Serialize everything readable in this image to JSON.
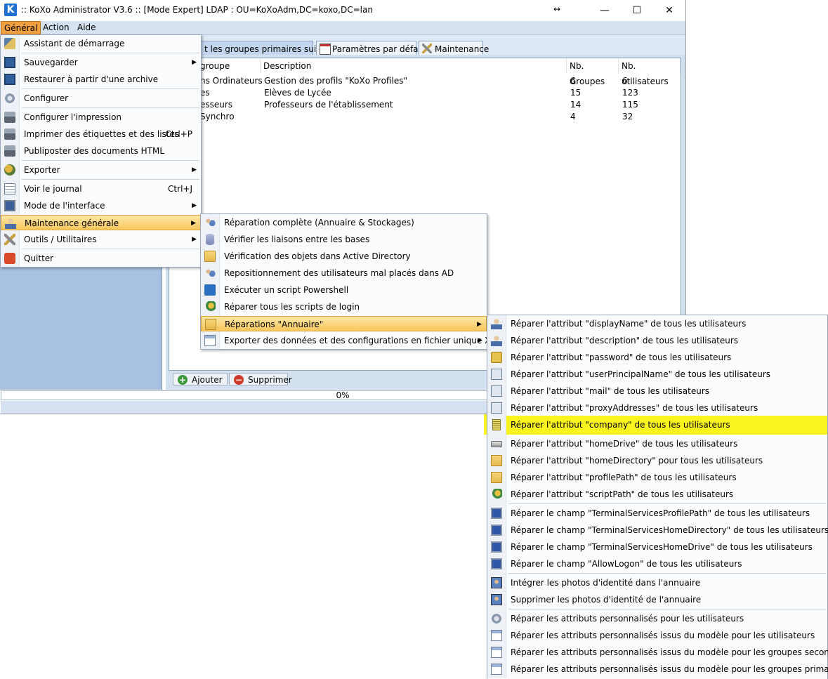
{
  "window": {
    "title": ":: KoXo Administrator V3.6 :: [Mode Expert] LDAP : OU=KoXoAdm,DC=koxo,DC=lan",
    "logo_letter": "K",
    "resize_glyph": "↔",
    "minimize_glyph": "—",
    "maximize_glyph": "☐",
    "close_glyph": "✕"
  },
  "menubar": {
    "items": [
      {
        "label": "Général"
      },
      {
        "label": "Action"
      },
      {
        "label": "Aide"
      }
    ]
  },
  "tabs": [
    {
      "label": "t les groupes primaires suivants",
      "icon": "group-icon"
    },
    {
      "label": "Paramètres par défaut",
      "icon": "calendar-icon"
    },
    {
      "label": "Maintenance",
      "icon": "tools-icon"
    }
  ],
  "grid": {
    "columns": [
      "groupe",
      "Description",
      "Nb. Groupes",
      "Nb. utilisateurs"
    ],
    "rows": [
      {
        "groupe": "ns Ordinateurs",
        "description": "Gestion des profils \"KoXo Profiles\"",
        "nb_groupes": "6",
        "nb_users": "6"
      },
      {
        "groupe": "es",
        "description": "Elèves de Lycée",
        "nb_groupes": "15",
        "nb_users": "123"
      },
      {
        "groupe": "esseurs",
        "description": "Professeurs de l'établissement",
        "nb_groupes": "14",
        "nb_users": "115"
      },
      {
        "groupe": "Synchro",
        "description": "",
        "nb_groupes": "4",
        "nb_users": "32"
      }
    ]
  },
  "bottom_toolbar": {
    "add_label": "Ajouter",
    "delete_label": "Supprimer"
  },
  "progress": {
    "text": "0%",
    "value": 0
  },
  "menu_general": {
    "items": [
      {
        "label": "Assistant de démarrage",
        "icon": "wizard-icon"
      },
      {
        "label": "Sauvegarder",
        "icon": "save-icon",
        "submenu": true
      },
      {
        "label": "Restaurer à partir d'une archive",
        "icon": "restore-icon"
      },
      {
        "label": "Configurer",
        "icon": "gear-icon"
      },
      {
        "label": "Configurer l'impression",
        "icon": "printer-icon"
      },
      {
        "label": "Imprimer des étiquettes et des listes",
        "icon": "printer-icon",
        "shortcut": "Ctrl+P"
      },
      {
        "label": "Publiposter des documents HTML",
        "icon": "printer-icon"
      },
      {
        "label": "Exporter",
        "icon": "export-icon",
        "submenu": true
      },
      {
        "label": "Voir le journal",
        "icon": "log-icon",
        "shortcut": "Ctrl+J"
      },
      {
        "label": "Mode de l'interface",
        "icon": "monitor-icon",
        "submenu": true
      },
      {
        "label": "Maintenance générale",
        "icon": "user-icon",
        "submenu": true
      },
      {
        "label": "Outils / Utilitaires",
        "icon": "tools-icon",
        "submenu": true
      },
      {
        "label": "Quitter",
        "icon": "quit-icon"
      }
    ]
  },
  "menu_maintenance": {
    "items": [
      {
        "label": "Réparation complète (Annuaire & Stockages)",
        "icon": "users-icon"
      },
      {
        "label": "Vérifier les liaisons entre les bases",
        "icon": "database-icon"
      },
      {
        "label": "Vérification des objets dans Active Directory",
        "icon": "folder-icon"
      },
      {
        "label": "Repositionnement des utilisateurs mal placés dans AD",
        "icon": "users-icon"
      },
      {
        "label": "Exécuter un script Powershell",
        "icon": "powershell-icon"
      },
      {
        "label": "Réparer tous les scripts de login",
        "icon": "script-icon"
      },
      {
        "label": "Réparations \"Annuaire\"",
        "icon": "folder-icon",
        "submenu": true
      },
      {
        "label": "Exporter des données et des configurations en fichier unique XML",
        "icon": "export-xml-icon",
        "submenu": true
      }
    ]
  },
  "menu_annuaire": {
    "items": [
      {
        "label": "Réparer l'attribut \"displayName\" de tous les utilisateurs",
        "icon": "user-icon"
      },
      {
        "label": "Réparer l'attribut \"description\" de tous les utilisateurs",
        "icon": "user-icon"
      },
      {
        "label": "Réparer l'attribut \"password\" de tous les utilisateurs",
        "icon": "key-icon"
      },
      {
        "label": "Réparer l'attribut \"userPrincipalName\" de tous les utilisateurs",
        "icon": "id-card-icon"
      },
      {
        "label": "Réparer l'attribut \"mail\" de tous les utilisateurs",
        "icon": "id-card-icon"
      },
      {
        "label": "Réparer l'attribut \"proxyAddresses\" de tous les utilisateurs",
        "icon": "id-card-icon"
      },
      {
        "label": "Réparer l'attribut \"company\" de tous les utilisateurs",
        "icon": "building-icon"
      },
      {
        "label": "Réparer l'attribut \"homeDrive\" de tous les utilisateurs",
        "icon": "drive-icon"
      },
      {
        "label": "Réparer l'attribut \"homeDirectory\" pour tous les utilisateurs",
        "icon": "folder-icon"
      },
      {
        "label": "Réparer l'attribut \"profilePath\" de tous les utilisateurs",
        "icon": "folder-icon"
      },
      {
        "label": "Réparer l'attribut \"scriptPath\" de tous les utilisateurs",
        "icon": "script-icon"
      },
      {
        "label": "Réparer le champ \"TerminalServicesProfilePath\" de tous les utilisateurs",
        "icon": "terminal-server-icon"
      },
      {
        "label": "Réparer le champ \"TerminalServicesHomeDirectory\" de tous les utilisateurs",
        "icon": "terminal-server-icon"
      },
      {
        "label": "Réparer le champ \"TerminalServicesHomeDrive\" de tous les utilisateurs",
        "icon": "terminal-server-icon"
      },
      {
        "label": "Réparer le champ \"AllowLogon\" de tous les utilisateurs",
        "icon": "terminal-server-icon"
      },
      {
        "label": "Intégrer les photos d'identité dans l'annuaire",
        "icon": "photo-icon"
      },
      {
        "label": "Supprimer les photos d'identité de l'annuaire",
        "icon": "photo-icon"
      },
      {
        "label": "Réparer les attributs personnalisés pour les utilisateurs",
        "icon": "gear-icon"
      },
      {
        "label": "Réparer les attributs personnalisés issus du modèle pour les utilisateurs",
        "icon": "document-icon"
      },
      {
        "label": "Réparer les attributs personnalisés issus du modèle pour les groupes secondaires",
        "icon": "document-icon"
      },
      {
        "label": "Réparer les attributs personnalisés issus du modèle pour les groupes primaires",
        "icon": "document-icon"
      }
    ]
  },
  "colors": {
    "menu_highlight": "#f7c75c",
    "annotation_highlight": "#faf41e",
    "menubar_active": "#f0a040"
  }
}
